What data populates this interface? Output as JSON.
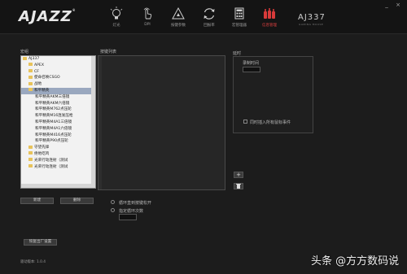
{
  "app": {
    "brand": "AJAZZ",
    "model": "AJ337",
    "model_sub": "GAMING MOUSE",
    "version_label": "驱动版本: 1.0.4",
    "colors": {
      "background": "#1c1c1c",
      "header": "#141414",
      "active": "#e04040"
    }
  },
  "window": {
    "minimize": "_",
    "close": "×"
  },
  "nav": {
    "items": [
      {
        "label": "灯光",
        "icon": "bulb-icon"
      },
      {
        "label": "DPI",
        "icon": "hand-pointer-icon"
      },
      {
        "label": "按键参数",
        "icon": "triangle-icon"
      },
      {
        "label": "回报率",
        "icon": "refresh-icon"
      },
      {
        "label": "宏管理器",
        "icon": "calculator-icon"
      },
      {
        "label": "信息管理",
        "icon": "bottles-icon",
        "active": true
      }
    ]
  },
  "macro": {
    "tree_label": "宏组",
    "root": "AJ337",
    "items": [
      {
        "label": "APEX",
        "type": "folder",
        "level": 1
      },
      {
        "label": "CF",
        "type": "folder",
        "level": 1
      },
      {
        "label": "使命召唤CSGO",
        "type": "folder",
        "level": 1
      },
      {
        "label": "战地",
        "type": "folder",
        "level": 1
      },
      {
        "label": "和平精英",
        "type": "folder",
        "level": 1,
        "selected": true
      },
      {
        "label": "和平精英AKM三倍镜",
        "type": "file",
        "level": 2
      },
      {
        "label": "和平精英AKM六倍镜",
        "type": "file",
        "level": 2
      },
      {
        "label": "和平精英M762点压轮",
        "type": "file",
        "level": 2
      },
      {
        "label": "和平精英M16连发压枪",
        "type": "file",
        "level": 2
      },
      {
        "label": "和平精英M4A1三倍镜",
        "type": "file",
        "level": 2
      },
      {
        "label": "和平精英M4A1六倍镜",
        "type": "file",
        "level": 2
      },
      {
        "label": "和平精英M416点压轮",
        "type": "file",
        "level": 2
      },
      {
        "label": "和平精英P90点压轮",
        "type": "file",
        "level": 2
      },
      {
        "label": "守望先锋",
        "type": "folder",
        "level": 1
      },
      {
        "label": "绝地吃鸡",
        "type": "folder",
        "level": 1
      },
      {
        "label": "光荣行动连射（测试",
        "type": "folder",
        "level": 1
      },
      {
        "label": "光荣行动连射（测试",
        "type": "folder",
        "level": 1
      }
    ],
    "new_button": "新建",
    "delete_button": "删除",
    "list_label": "按键列表",
    "delay_label": "延时",
    "delay_field_label": "录制时间",
    "delay_value": "",
    "option_checkbox": "同时插入所有鼠标事件",
    "add_button": "+",
    "remove_icon": "trash-icon",
    "radio_until_release": "循环直到按键松开",
    "radio_loop_count": "指定循环次数",
    "loop_count_value": "",
    "restore_button": "恢复出厂设置"
  },
  "watermark": "头条 @方方数码说"
}
